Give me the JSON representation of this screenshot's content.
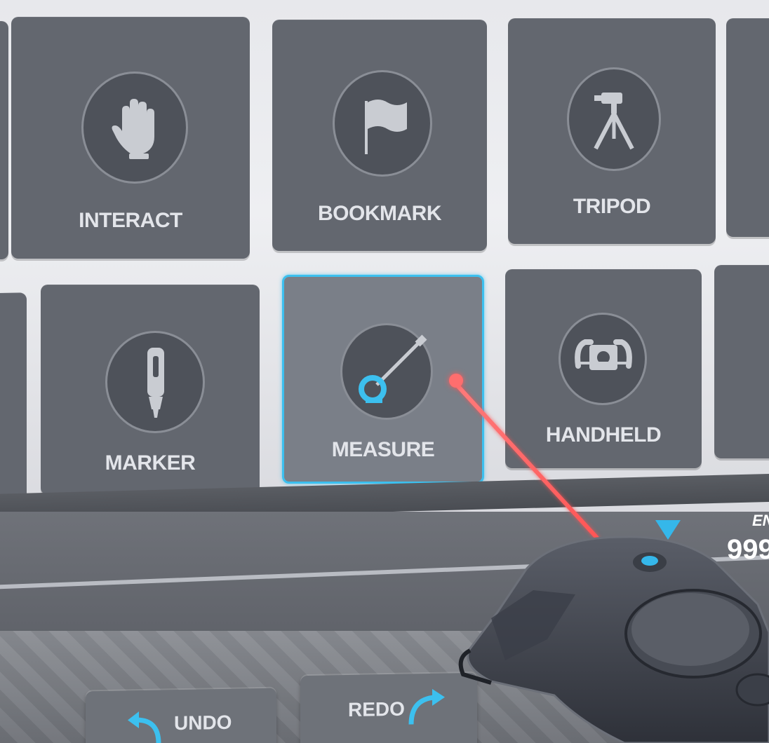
{
  "tiles_row1": [
    {
      "label": "INTERACT",
      "icon": "hand-icon"
    },
    {
      "label": "BOOKMARK",
      "icon": "flag-icon"
    },
    {
      "label": "TRIPOD",
      "icon": "tripod-icon"
    }
  ],
  "tiles_row2": [
    {
      "label": "MARKER",
      "icon": "marker-pen-icon"
    },
    {
      "label": "MEASURE",
      "icon": "tape-measure-icon",
      "selected": true
    },
    {
      "label": "HANDHELD",
      "icon": "handheld-camera-icon"
    }
  ],
  "toolbar": {
    "undo_label": "UNDO",
    "redo_label": "REDO"
  },
  "side_readout": {
    "label_partial": "EN",
    "value_partial": "999"
  },
  "colors": {
    "tile": "#63676f",
    "selection": "#3cc0ef",
    "laser": "#ff5a5a"
  }
}
